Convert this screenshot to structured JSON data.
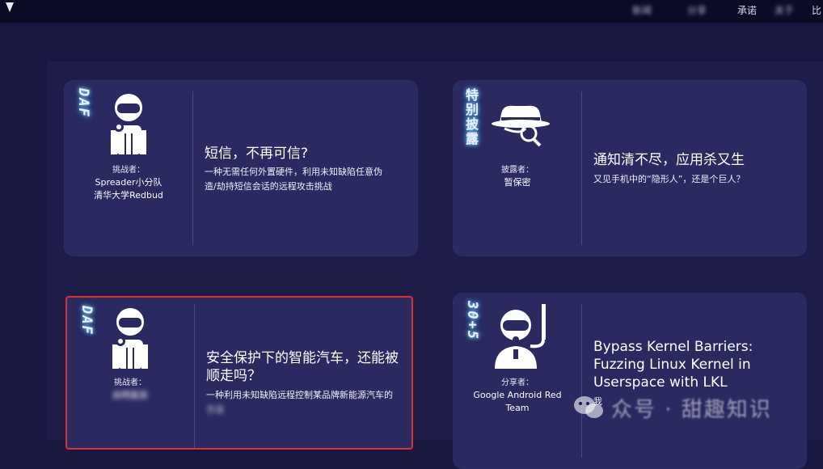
{
  "nav": {
    "items": [
      "新闻",
      "分享",
      "承诺",
      "关于",
      "比"
    ]
  },
  "cards": [
    {
      "tag": "DAF",
      "role_label": "挑战者：",
      "names": [
        "Spreader小分队",
        "清华大学Redbud"
      ],
      "title": "短信，不再可信?",
      "desc": [
        "一种无需任何外置硬件，利用未知缺陷任意伪",
        "造/劫持短信会话的远程攻击挑战"
      ]
    },
    {
      "tag": "特别披露",
      "role_label": "披露者：",
      "names": [
        "暂保密"
      ],
      "title": "通知清不尽，应用杀又生",
      "desc": [
        "又见手机中的“隐形人”，还是个巨人？"
      ]
    },
    {
      "tag": "DAF",
      "role_label": "挑战者：",
      "names": [
        "启明星辰"
      ],
      "title_lines": [
        "安全保护下的智能汽车，还能被",
        "顺走吗？"
      ],
      "desc": [
        "一种利用未知缺陷远程控制某品牌新能源汽车的",
        "方法"
      ]
    },
    {
      "tag": "30+5",
      "role_label": "分享者：",
      "names": [
        "Google Android Red",
        "Team"
      ],
      "title_lines": [
        "Bypass Kernel Barriers:",
        "Fuzzing Linux Kernel in",
        "Userspace with LKL"
      ],
      "desc": [
        "我"
      ]
    }
  ],
  "watermark": {
    "text": "众号 · 甜趣知识"
  }
}
